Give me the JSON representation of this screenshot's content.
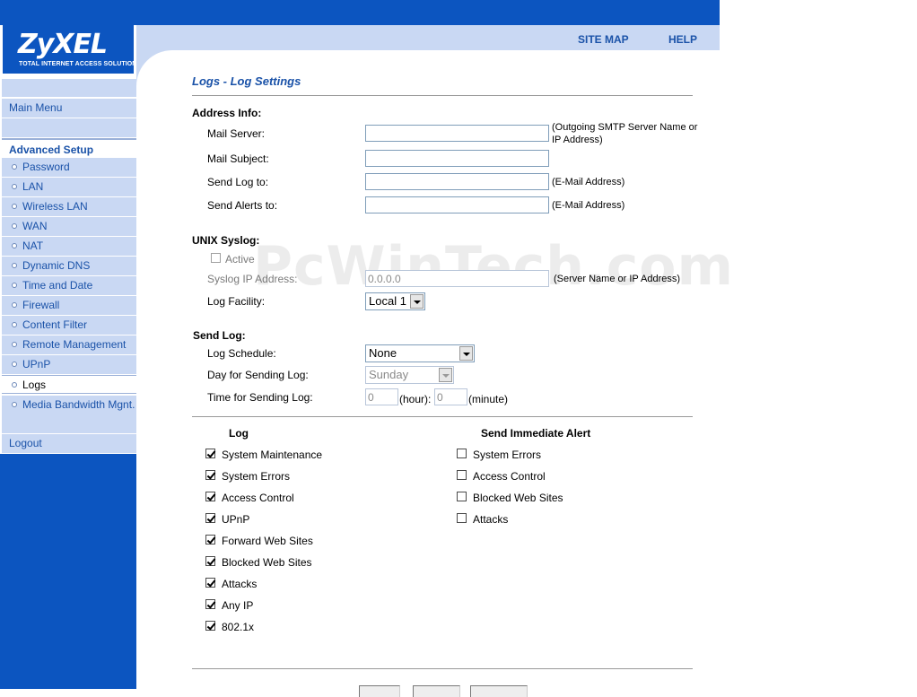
{
  "brand": {
    "name": "ZyXEL",
    "tagline": "TOTAL INTERNET ACCESS SOLUTION"
  },
  "top_links": {
    "site_map": "SITE MAP",
    "help": "HELP"
  },
  "sidebar": {
    "main_menu": "Main Menu",
    "section": "Advanced Setup",
    "items": [
      "Password",
      "LAN",
      "Wireless LAN",
      "WAN",
      "NAT",
      "Dynamic DNS",
      "Time and Date",
      "Firewall",
      "Content Filter",
      "Remote Management",
      "UPnP",
      "Logs",
      "Media Bandwidth Mgnt."
    ],
    "active": "Logs",
    "logout": "Logout"
  },
  "page": {
    "title": "Logs - Log Settings"
  },
  "address_info": {
    "heading": "Address Info:",
    "mail_server_label": "Mail Server:",
    "mail_server_note_1": "(Outgoing SMTP Server Name or",
    "mail_server_note_2": "IP Address)",
    "mail_subject_label": "Mail Subject:",
    "send_log_to_label": "Send Log to:",
    "send_log_to_note": "(E-Mail Address)",
    "send_alerts_to_label": "Send Alerts to:",
    "send_alerts_to_note": "(E-Mail Address)"
  },
  "unix_syslog": {
    "heading": "UNIX Syslog:",
    "active_label": "Active",
    "ip_label": "Syslog IP Address:",
    "ip_value": "0.0.0.0",
    "ip_note": "(Server Name or IP Address)",
    "facility_label": "Log Facility:",
    "facility_value": "Local 1"
  },
  "send_log": {
    "heading": "Send Log:",
    "schedule_label": "Log Schedule:",
    "schedule_value": "None",
    "day_label": "Day for Sending Log:",
    "day_value": "Sunday",
    "time_label": "Time for Sending Log:",
    "hour_value": "0",
    "hour_unit": "(hour):",
    "minute_value": "0",
    "minute_unit": "(minute)"
  },
  "log_columns": {
    "log_heading": "Log",
    "alert_heading": "Send Immediate Alert",
    "log_items": [
      "System Maintenance",
      "System Errors",
      "Access Control",
      "UPnP",
      "Forward Web Sites",
      "Blocked Web Sites",
      "Attacks",
      "Any IP",
      "802.1x"
    ],
    "alert_items": [
      "System Errors",
      "Access Control",
      "Blocked Web Sites",
      "Attacks"
    ]
  },
  "watermark": "PcWinTech.com"
}
